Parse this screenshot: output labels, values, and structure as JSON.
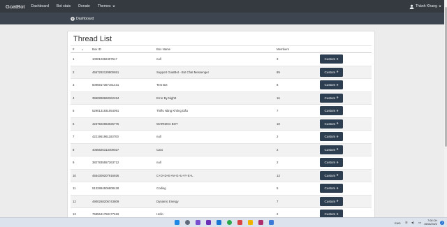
{
  "nav": {
    "brand": "GoatBot",
    "links": [
      "Dashboard",
      "Bot stats",
      "Donate",
      "Themes"
    ],
    "user": "Thành Khang"
  },
  "subnav": {
    "dashboard": "Dashboard"
  },
  "page": {
    "title": "Thread List"
  },
  "table": {
    "headers": [
      "#",
      "Box ID",
      "Box Name",
      "Members",
      ""
    ],
    "rows": [
      {
        "n": "1",
        "id": "100010382497517",
        "name": "null",
        "members": "3",
        "action": "Custom"
      },
      {
        "n": "2",
        "id": "4567292129900651",
        "name": "Support GoatBot - Bot Chat Messenger",
        "members": "89",
        "action": "Custom"
      },
      {
        "n": "3",
        "id": "5095817367161431",
        "name": "Test Bot",
        "members": "8",
        "action": "Custom"
      },
      {
        "n": "4",
        "id": "3950898668362484",
        "name": "Error By Nightt",
        "members": "16",
        "action": "Custom"
      },
      {
        "n": "5",
        "id": "5290131931054091",
        "name": "Thiếu Năng Không Dấu",
        "members": "7",
        "action": "Custom"
      },
      {
        "n": "6",
        "id": "4237502963025776",
        "name": "WARNING BOT",
        "members": "18",
        "action": "Custom"
      },
      {
        "n": "7",
        "id": "4221961961183700",
        "name": "null",
        "members": "2",
        "action": "Custom"
      },
      {
        "n": "8",
        "id": "4066826313409027",
        "name": "Caro",
        "members": "2",
        "action": "Custom"
      },
      {
        "n": "9",
        "id": "3827835557263712",
        "name": "null",
        "members": "2",
        "action": "Custom"
      },
      {
        "n": "10",
        "id": "4554309207916926",
        "name": "C+O+D+E+N+G+U+Y+E+L",
        "members": "13",
        "action": "Custom"
      },
      {
        "n": "11",
        "id": "5132884506808428",
        "name": "Coding",
        "members": "5",
        "action": "Custom"
      },
      {
        "n": "12",
        "id": "4900268206743809",
        "name": "Dynamic Energy",
        "members": "7",
        "action": "Custom"
      },
      {
        "n": "13",
        "id": "7585641758177619",
        "name": "Hello",
        "members": "2",
        "action": "Custom"
      }
    ]
  },
  "taskbar": {
    "lang": "ENG",
    "time": "7:08 CH",
    "date": "15/06/2022",
    "notifications": "2"
  },
  "colors": {
    "navbar": "#343a40",
    "subnav": "#3c4550",
    "button": "#2d3e50",
    "background": "#ececec"
  }
}
